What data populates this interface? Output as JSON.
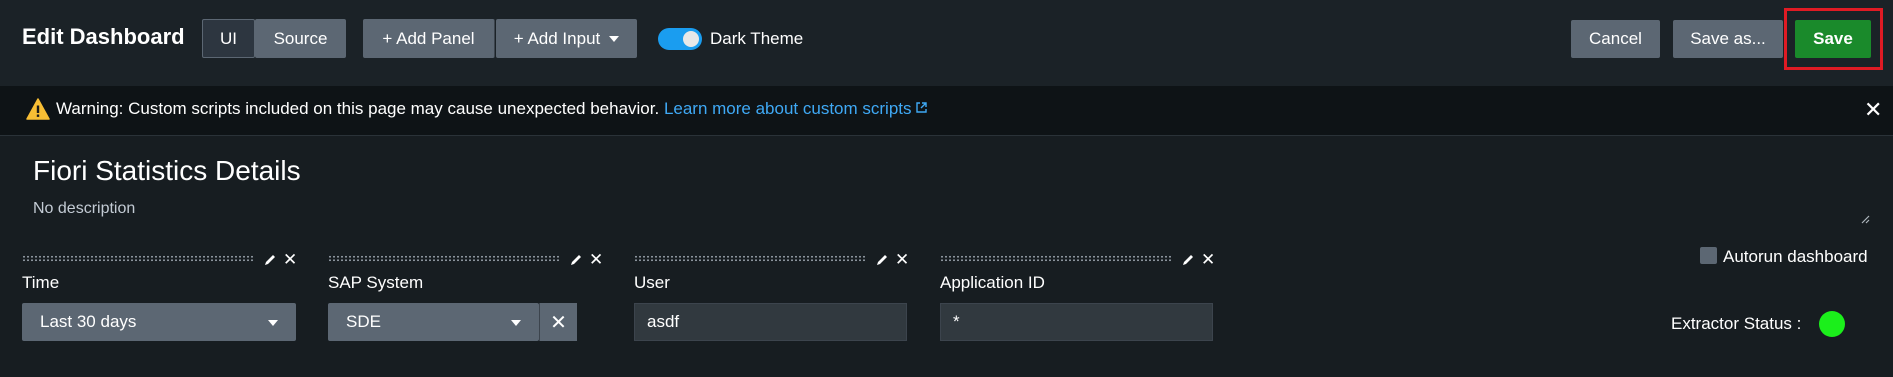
{
  "header": {
    "title": "Edit Dashboard",
    "mode_tabs": [
      "UI",
      "Source"
    ],
    "add_panel_label": "+ Add Panel",
    "add_input_label": "+ Add Input",
    "theme_toggle_label": "Dark Theme",
    "theme_toggle_on": true,
    "cancel_label": "Cancel",
    "save_as_label": "Save as...",
    "save_label": "Save",
    "accent_color": "#1a9df0",
    "save_color": "#1a8a2b"
  },
  "warning": {
    "text": "Warning: Custom scripts included on this page may cause unexpected behavior.",
    "link_text": "Learn more about custom scripts",
    "icon": "warning-triangle-icon"
  },
  "dashboard": {
    "title": "Fiori Statistics Details",
    "description": "No description"
  },
  "inputs": [
    {
      "label": "Time",
      "type": "dropdown",
      "value": "Last 30 days"
    },
    {
      "label": "SAP System",
      "type": "dropdown",
      "value": "SDE",
      "clearable": true
    },
    {
      "label": "User",
      "type": "text",
      "value": "asdf"
    },
    {
      "label": "Application ID",
      "type": "text",
      "value": "*"
    }
  ],
  "autorun": {
    "label": "Autorun dashboard",
    "checked": false
  },
  "extractor": {
    "label": "Extractor Status :",
    "status_color": "#1bef1b"
  }
}
